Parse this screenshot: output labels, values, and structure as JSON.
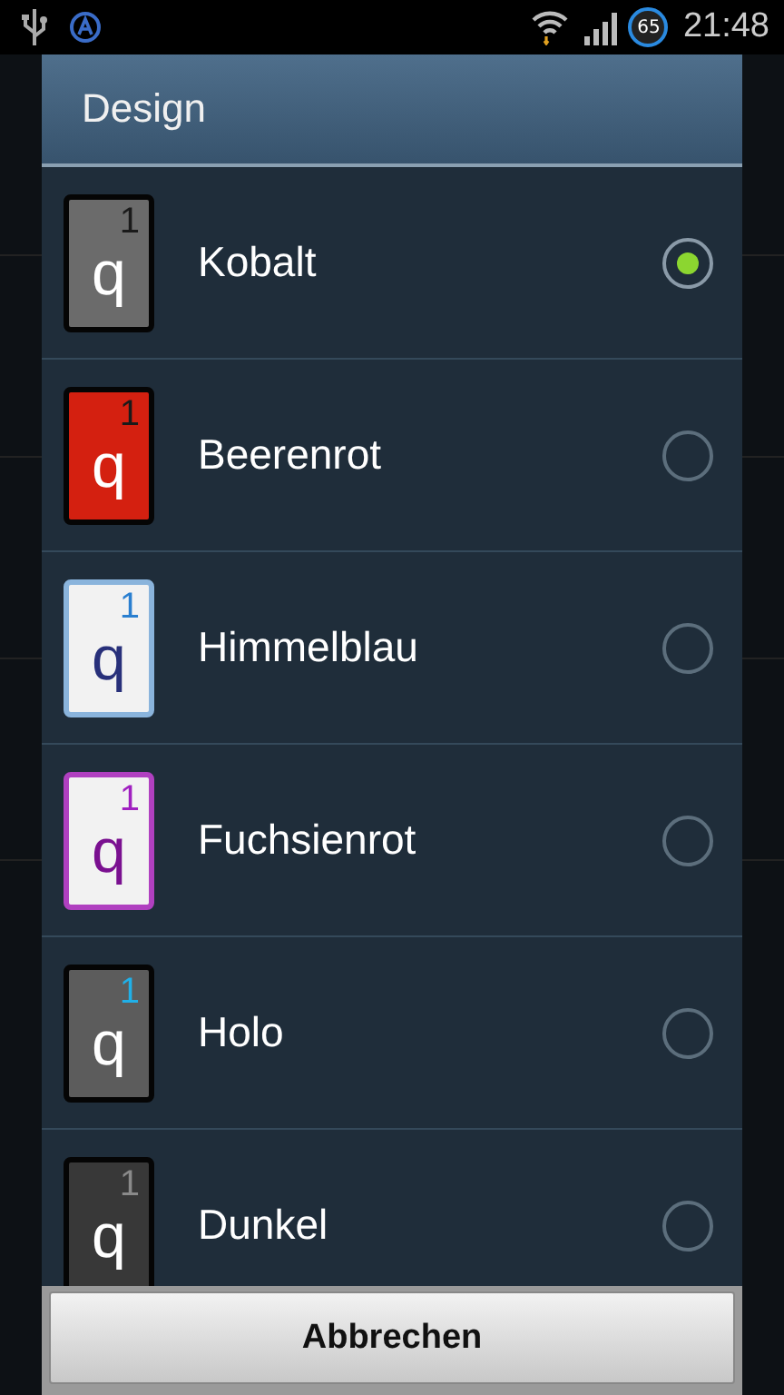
{
  "status_bar": {
    "battery": "65",
    "time": "21:48"
  },
  "dialog": {
    "title": "Design",
    "options": [
      {
        "label": "Kobalt",
        "selected": true,
        "color": "#6b6b6b",
        "kind": "dark",
        "digit": {
          "text": "1",
          "color": "#1a1a1a"
        },
        "letter": {
          "text": "q",
          "color": "#ffffff"
        }
      },
      {
        "label": "Beerenrot",
        "selected": false,
        "color": "#d42010",
        "kind": "dark",
        "digit": {
          "text": "1",
          "color": "#1a1a1a"
        },
        "letter": {
          "text": "q",
          "color": "#ffffff"
        }
      },
      {
        "label": "Himmelblau",
        "selected": false,
        "color": "#8ab4dc",
        "kind": "light",
        "digit": {
          "text": "1",
          "color": "#2a7fd0"
        },
        "letter": {
          "text": "q",
          "color": "#28307a"
        }
      },
      {
        "label": "Fuchsienrot",
        "selected": false,
        "color": "#b040c0",
        "kind": "light",
        "digit": {
          "text": "1",
          "color": "#a020c0"
        },
        "letter": {
          "text": "q",
          "color": "#7a1090"
        }
      },
      {
        "label": "Holo",
        "selected": false,
        "color": "#5c5c5c",
        "kind": "dark",
        "digit": {
          "text": "1",
          "color": "#20b0e8"
        },
        "letter": {
          "text": "q",
          "color": "#ffffff"
        }
      },
      {
        "label": "Dunkel",
        "selected": false,
        "color": "#383838",
        "kind": "dark",
        "digit": {
          "text": "1",
          "color": "#8a8a8a"
        },
        "letter": {
          "text": "q",
          "color": "#ffffff"
        }
      }
    ],
    "cancel_button": "Abbrechen"
  }
}
